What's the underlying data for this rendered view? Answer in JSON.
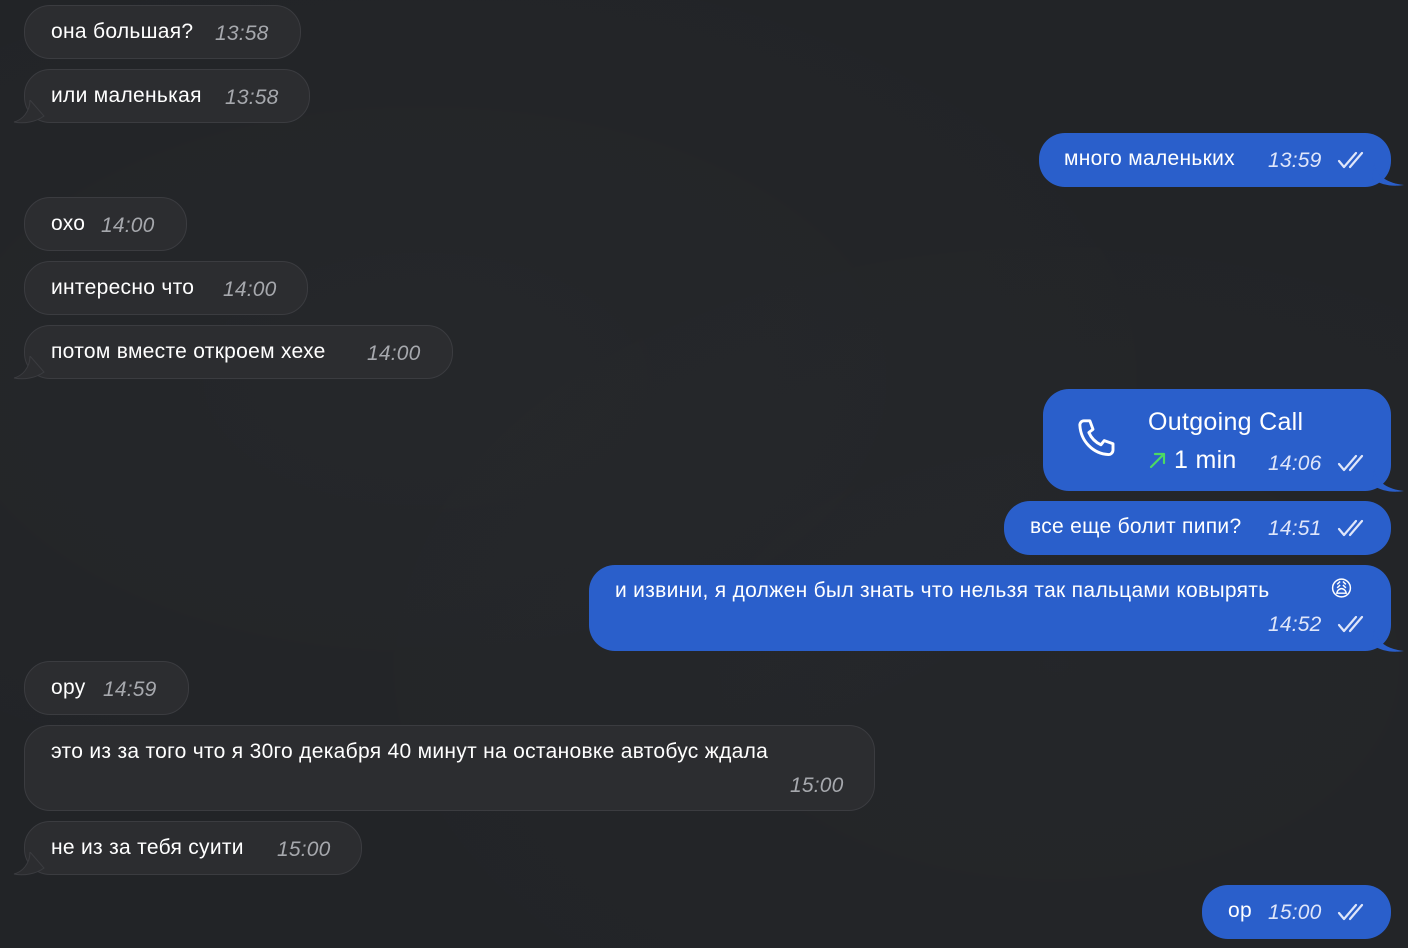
{
  "messages": [
    {
      "side": "in",
      "text": "она большая?",
      "time": "13:58"
    },
    {
      "side": "in",
      "text": "или маленькая",
      "time": "13:58"
    },
    {
      "side": "out",
      "text": "много маленьких",
      "time": "13:59"
    },
    {
      "side": "in",
      "text": "охо",
      "time": "14:00"
    },
    {
      "side": "in",
      "text": "интересно что",
      "time": "14:00"
    },
    {
      "side": "in",
      "text": "потом вместе откроем хехе",
      "time": "14:00"
    },
    {
      "side": "out",
      "type": "call",
      "title": "Outgoing Call",
      "duration": "1 min",
      "time": "14:06",
      "icon": "phone-icon",
      "arrow_icon": "arrow-up-right-icon",
      "arrow_color": "#4cd964"
    },
    {
      "side": "out",
      "text": "все еще болит пипи?",
      "time": "14:51"
    },
    {
      "side": "out",
      "text": "и извини, я должен был знать что нельзя так пальцами ковырять",
      "emoji": "😩",
      "time": "14:52"
    },
    {
      "side": "in",
      "text": "ору",
      "time": "14:59"
    },
    {
      "side": "in",
      "text": "это из за того что я 30го декабря 40 минут на остановке автобус ждала",
      "time": "15:00"
    },
    {
      "side": "in",
      "text": "не из за тебя суити",
      "time": "15:00"
    },
    {
      "side": "out",
      "text": "ор",
      "time": "15:00"
    }
  ],
  "colors": {
    "background": "#222427",
    "incoming_bubble": "#2c2d30",
    "outgoing_bubble": "#2a5fcb"
  }
}
